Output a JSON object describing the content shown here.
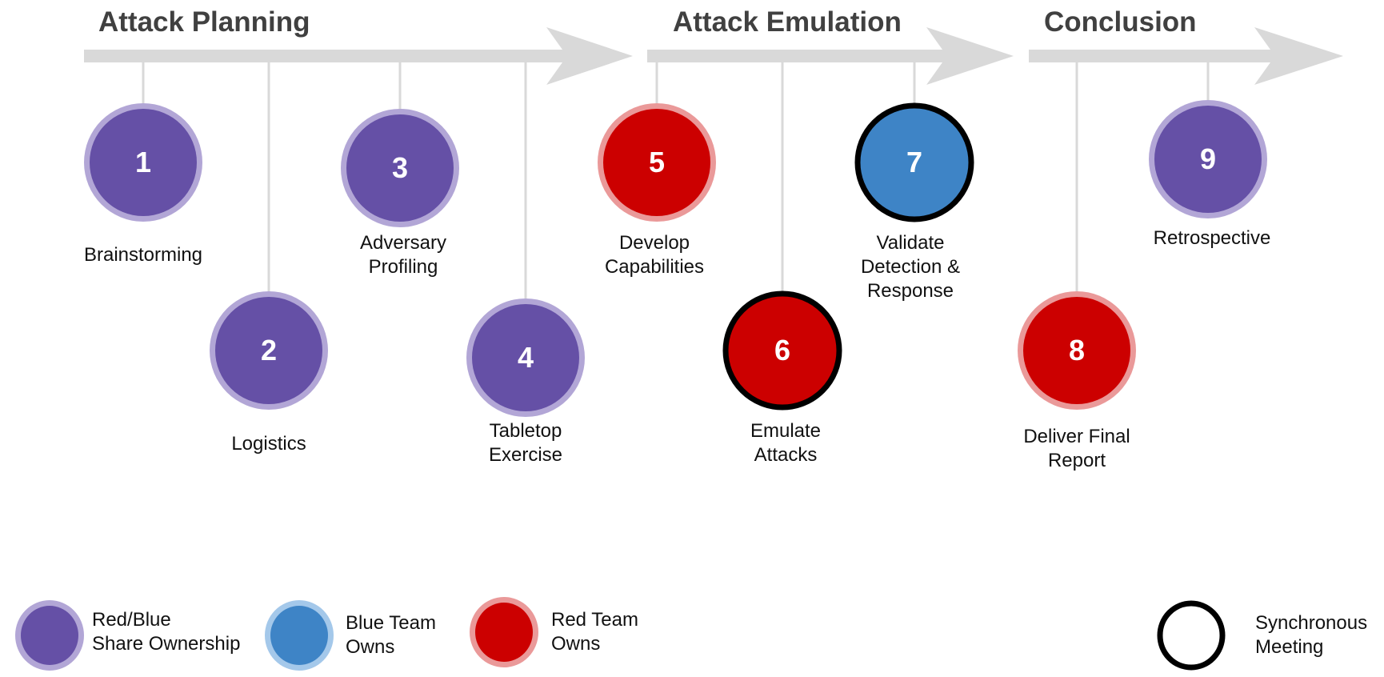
{
  "phases": [
    {
      "title": "Attack Planning"
    },
    {
      "title": "Attack Emulation"
    },
    {
      "title": "Conclusion"
    }
  ],
  "colors": {
    "shared_fill": "#6550a6",
    "shared_ring": "#b2a6d6",
    "blue_fill": "#3e84c6",
    "blue_ring": "#a4c8ea",
    "red_fill": "#cc0000",
    "red_ring": "#ea9999",
    "sync_border": "#000000",
    "arrow": "#d9d9d9",
    "connector": "#d9d9d9",
    "title_text": "#404040"
  },
  "steps": [
    {
      "number": "1",
      "label": "Brainstorming",
      "phase": "Attack Planning",
      "owner": "shared",
      "synchronous": false
    },
    {
      "number": "2",
      "label": "Logistics",
      "phase": "Attack Planning",
      "owner": "shared",
      "synchronous": false
    },
    {
      "number": "3",
      "label": "Adversary\nProfiling",
      "phase": "Attack Planning",
      "owner": "shared",
      "synchronous": false
    },
    {
      "number": "4",
      "label": "Tabletop\nExercise",
      "phase": "Attack Planning",
      "owner": "shared",
      "synchronous": false
    },
    {
      "number": "5",
      "label": "Develop\nCapabilities",
      "phase": "Attack Emulation",
      "owner": "red",
      "synchronous": false
    },
    {
      "number": "6",
      "label": "Emulate\nAttacks",
      "phase": "Attack Emulation",
      "owner": "red",
      "synchronous": true
    },
    {
      "number": "7",
      "label": "Validate\nDetection &\nResponse",
      "phase": "Attack Emulation",
      "owner": "blue",
      "synchronous": true
    },
    {
      "number": "8",
      "label": "Deliver Final\nReport",
      "phase": "Conclusion",
      "owner": "red",
      "synchronous": false
    },
    {
      "number": "9",
      "label": "Retrospective",
      "phase": "Conclusion",
      "owner": "shared",
      "synchronous": false
    }
  ],
  "legend": {
    "items": [
      {
        "key": "shared",
        "label": "Red/Blue\nShare Ownership"
      },
      {
        "key": "blue",
        "label": "Blue Team\nOwns"
      },
      {
        "key": "red",
        "label": "Red Team\nOwns"
      },
      {
        "key": "sync",
        "label": "Synchronous\nMeeting"
      }
    ]
  }
}
